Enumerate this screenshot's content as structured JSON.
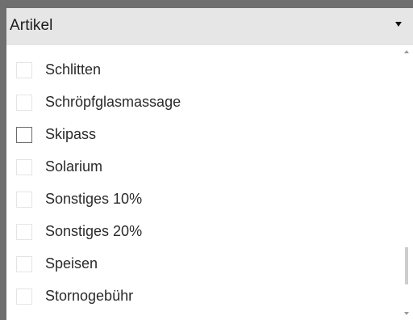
{
  "dropdown": {
    "selected_label": "Artikel",
    "caret_icon": "caret-down-icon"
  },
  "list": {
    "items": [
      {
        "label": "Schlitten",
        "checked": false,
        "highlighted": false
      },
      {
        "label": "Schröpfglasmassage",
        "checked": false,
        "highlighted": false
      },
      {
        "label": "Skipass",
        "checked": false,
        "highlighted": true
      },
      {
        "label": "Solarium",
        "checked": false,
        "highlighted": false
      },
      {
        "label": "Sonstiges 10%",
        "checked": false,
        "highlighted": false
      },
      {
        "label": "Sonstiges 20%",
        "checked": false,
        "highlighted": false
      },
      {
        "label": "Speisen",
        "checked": false,
        "highlighted": false
      },
      {
        "label": "Stornogebühr",
        "checked": false,
        "highlighted": false
      }
    ]
  },
  "colors": {
    "frame": "#6f6f6f",
    "header_bg": "#e6e6e6",
    "checkbox_border": "#e4e4e4",
    "checkbox_border_active": "#6a6a6a",
    "text": "#2a2a2a"
  }
}
